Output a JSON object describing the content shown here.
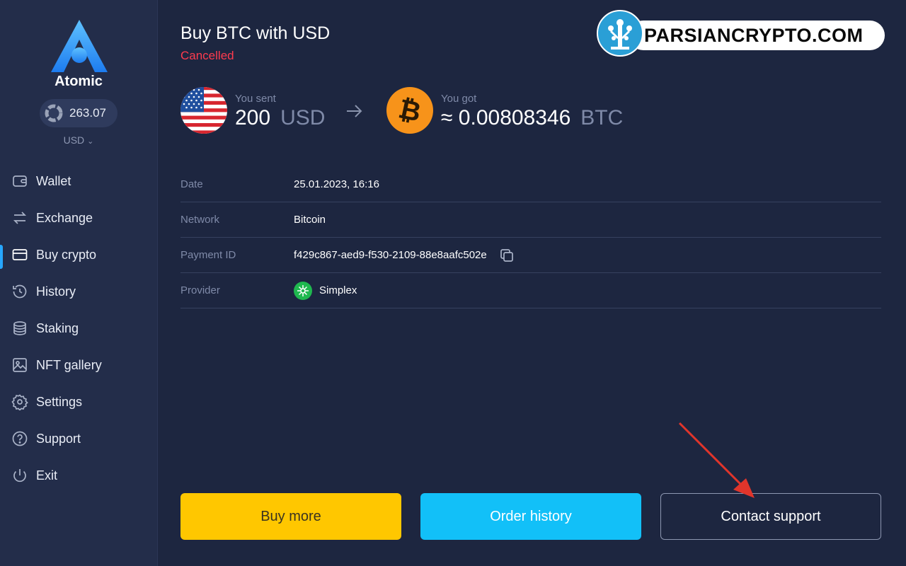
{
  "sidebar": {
    "brand": "Atomic",
    "balance": "263.07",
    "currency": "USD",
    "items": [
      {
        "label": "Wallet",
        "icon": "wallet-icon"
      },
      {
        "label": "Exchange",
        "icon": "exchange-icon"
      },
      {
        "label": "Buy crypto",
        "icon": "card-icon",
        "active": true
      },
      {
        "label": "History",
        "icon": "history-icon"
      },
      {
        "label": "Staking",
        "icon": "staking-icon"
      },
      {
        "label": "NFT gallery",
        "icon": "image-icon"
      },
      {
        "label": "Settings",
        "icon": "gear-icon"
      },
      {
        "label": "Support",
        "icon": "question-icon"
      },
      {
        "label": "Exit",
        "icon": "power-icon"
      }
    ]
  },
  "main": {
    "title": "Buy BTC with USD",
    "status": "Cancelled",
    "sent": {
      "label": "You sent",
      "amount": "200",
      "unit": "USD"
    },
    "got": {
      "label": "You got",
      "amount": "≈ 0.00808346",
      "unit": "BTC"
    },
    "details": [
      {
        "key": "Date",
        "value": "25.01.2023, 16:16"
      },
      {
        "key": "Network",
        "value": "Bitcoin"
      },
      {
        "key": "Payment ID",
        "value": "f429c867-aed9-f530-2109-88e8aafc502e"
      },
      {
        "key": "Provider",
        "value": "Simplex"
      }
    ],
    "buttons": {
      "buy_more": "Buy more",
      "order_history": "Order history",
      "contact_support": "Contact support"
    }
  },
  "watermark": {
    "text": "PARSIANCRYPTO.COM"
  },
  "colors": {
    "background": "#1d2640",
    "sidebar": "#232d4a",
    "accent": "#27a7ff",
    "cancelled": "#ff3b4e",
    "buy_button": "#ffc700",
    "history_button": "#12c0f8"
  }
}
